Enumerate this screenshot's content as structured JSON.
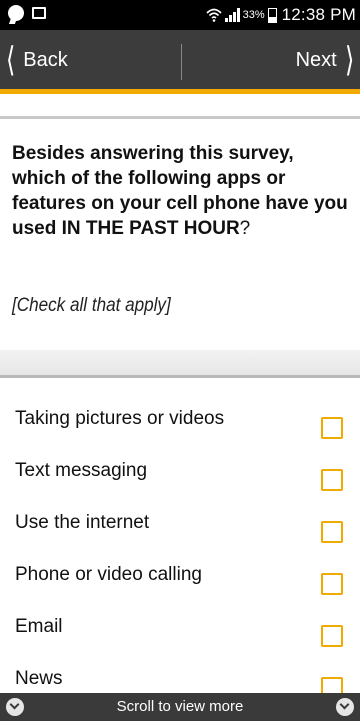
{
  "status_bar": {
    "battery_percent": "33%",
    "time": "12:38 PM",
    "icons": [
      "message-icon",
      "image-icon",
      "wifi-icon",
      "signal-icon",
      "battery-icon"
    ]
  },
  "nav": {
    "back_label": "Back",
    "next_label": "Next"
  },
  "question": {
    "text_part1": "Besides answering this survey, which of the following apps or features on your cell phone have you used ",
    "text_caps": "IN THE PAST HOUR",
    "text_tail": "?",
    "instruction": "[Check all that apply]"
  },
  "options": [
    {
      "label": "Taking pictures or videos",
      "checked": false
    },
    {
      "label": "Text messaging",
      "checked": false
    },
    {
      "label": "Use the internet",
      "checked": false
    },
    {
      "label": "Phone or video calling",
      "checked": false
    },
    {
      "label": "Email",
      "checked": false
    },
    {
      "label": "News",
      "checked": false
    }
  ],
  "footer": {
    "scroll_text": "Scroll to view more"
  },
  "colors": {
    "accent": "#f2a900",
    "nav_bg": "#3c3c3c",
    "status_bg": "#000000"
  }
}
